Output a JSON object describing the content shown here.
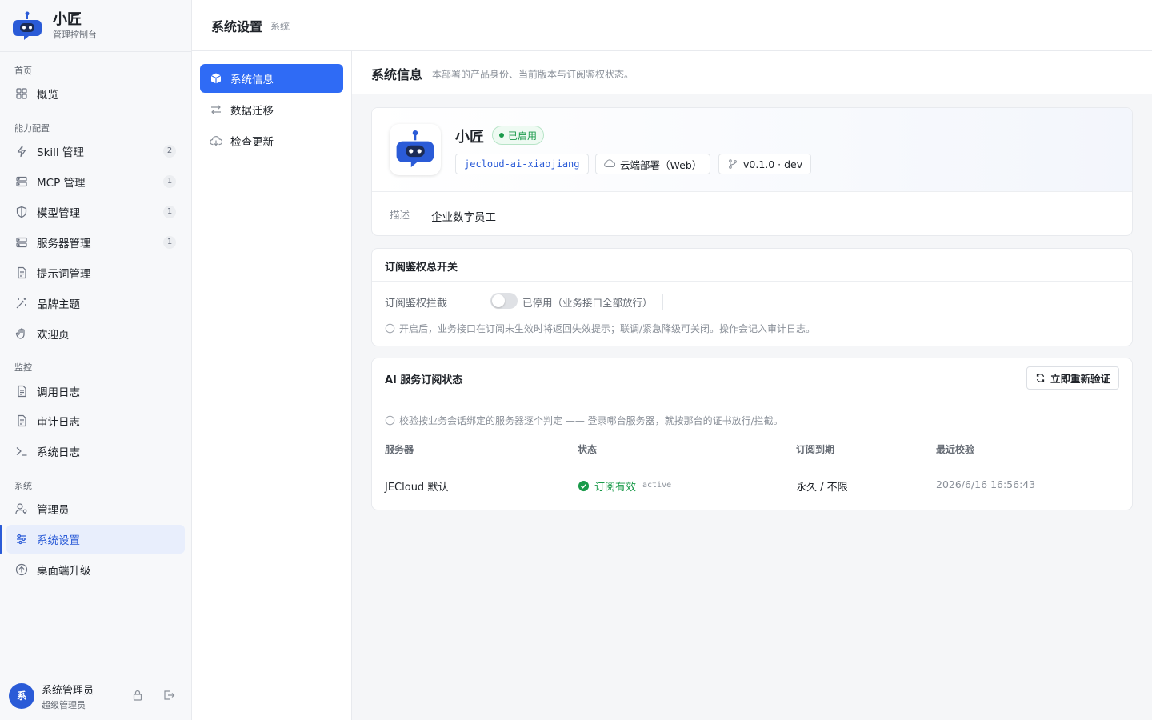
{
  "brand": {
    "name": "小匠",
    "subtitle": "管理控制台"
  },
  "sidebar": {
    "groups": {
      "home": "首页",
      "capability": "能力配置",
      "monitor": "监控",
      "system": "系统"
    },
    "items": {
      "overview": {
        "label": "概览",
        "icon": "grid-icon"
      },
      "skill": {
        "label": "Skill 管理",
        "badge": "2",
        "icon": "bolt-icon"
      },
      "mcp": {
        "label": "MCP 管理",
        "badge": "1",
        "icon": "server-icon"
      },
      "model": {
        "label": "模型管理",
        "badge": "1",
        "icon": "shield-icon"
      },
      "servers": {
        "label": "服务器管理",
        "badge": "1",
        "icon": "server-icon"
      },
      "prompt": {
        "label": "提示词管理",
        "icon": "document-icon"
      },
      "brand_theme": {
        "label": "品牌主题",
        "icon": "magic-wand-icon"
      },
      "welcome": {
        "label": "欢迎页",
        "icon": "wave-hand-icon"
      },
      "call_log": {
        "label": "调用日志",
        "icon": "document-icon"
      },
      "audit_log": {
        "label": "审计日志",
        "icon": "document-icon"
      },
      "system_log": {
        "label": "系统日志",
        "icon": "terminal-icon"
      },
      "admins": {
        "label": "管理员",
        "icon": "user-key-icon"
      },
      "settings": {
        "label": "系统设置",
        "icon": "sliders-icon",
        "active": true
      },
      "desktop_upgrade": {
        "label": "桌面端升级",
        "icon": "arrow-up-circle-icon"
      }
    },
    "user": {
      "avatar": "系",
      "name": "系统管理员",
      "role": "超级管理员"
    }
  },
  "header": {
    "title": "系统设置",
    "crumb": "系统"
  },
  "subnav": {
    "items": [
      {
        "label": "系统信息",
        "icon": "cube-icon",
        "active": true
      },
      {
        "label": "数据迁移",
        "icon": "swap-icon"
      },
      {
        "label": "检查更新",
        "icon": "cloud-download-icon"
      }
    ]
  },
  "main": {
    "title": "系统信息",
    "description": "本部署的产品身份、当前版本与订阅鉴权状态。",
    "product": {
      "name": "小匠",
      "status": "已启用",
      "code": "jecloud-ai-xiaojiang",
      "deploy": "云端部署（Web）",
      "version": "v0.1.0 · dev",
      "desc_label": "描述",
      "desc_value": "企业数字员工"
    },
    "auth_switch": {
      "title": "订阅鉴权总开关",
      "label": "订阅鉴权拦截",
      "enabled": false,
      "state_text": "已停用（业务接口全部放行）",
      "hint": "开启后，业务接口在订阅未生效时将返回失效提示；联调/紧急降级可关闭。操作会记入审计日志。"
    },
    "subscription": {
      "title": "AI 服务订阅状态",
      "reverify_label": "立即重新验证",
      "hint": "校验按业务会话绑定的服务器逐个判定 —— 登录哪台服务器，就按那台的证书放行/拦截。",
      "columns": [
        "服务器",
        "状态",
        "订阅到期",
        "最近校验"
      ],
      "rows": [
        {
          "server": "JECloud 默认",
          "status": "订阅有效",
          "status_code": "active",
          "expiry": "永久 / 不限",
          "last_check": "2026/6/16 16:56:43"
        }
      ]
    }
  },
  "colors": {
    "accent": "#2f6bf5",
    "success": "#1a9a4a"
  }
}
